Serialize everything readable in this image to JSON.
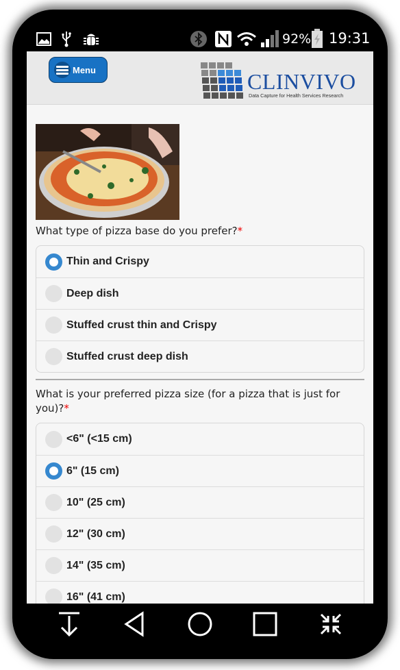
{
  "status_bar": {
    "left_icons": [
      "image-icon",
      "usb-icon",
      "android-debug-icon"
    ],
    "right_icons": [
      "bluetooth-icon",
      "nfc-icon",
      "wifi-icon",
      "signal-icon"
    ],
    "battery_percent": "92%",
    "time": "19:31"
  },
  "header": {
    "menu_label": "Menu",
    "logo_title": "CLINVIVO",
    "logo_subtitle": "Data Capture for Health Services Research"
  },
  "colors": {
    "accent": "#1872c4",
    "radio_checked": "#3688cf",
    "required": "#ee0000"
  },
  "image": {
    "alt": "Pizza being sliced on a plate"
  },
  "questions": [
    {
      "text": "What type of pizza base do you prefer?",
      "required_mark": "*",
      "options": [
        {
          "label": "Thin and Crispy",
          "checked": true
        },
        {
          "label": "Deep dish",
          "checked": false
        },
        {
          "label": "Stuffed crust thin and Crispy",
          "checked": false
        },
        {
          "label": "Stuffed crust deep dish",
          "checked": false
        }
      ]
    },
    {
      "text": "What is your preferred pizza size (for a pizza that is just for you)?",
      "required_mark": "*",
      "options": [
        {
          "label": "<6\" (<15 cm)",
          "checked": false
        },
        {
          "label": "6\" (15 cm)",
          "checked": true
        },
        {
          "label": "10\" (25 cm)",
          "checked": false
        },
        {
          "label": "12\" (30 cm)",
          "checked": false
        },
        {
          "label": "14\" (35 cm)",
          "checked": false
        },
        {
          "label": "16\" (41 cm)",
          "checked": false
        }
      ]
    }
  ],
  "nav_bar": [
    "hide-keyboard-icon",
    "back-icon",
    "home-icon",
    "recents-icon",
    "collapse-icon"
  ]
}
